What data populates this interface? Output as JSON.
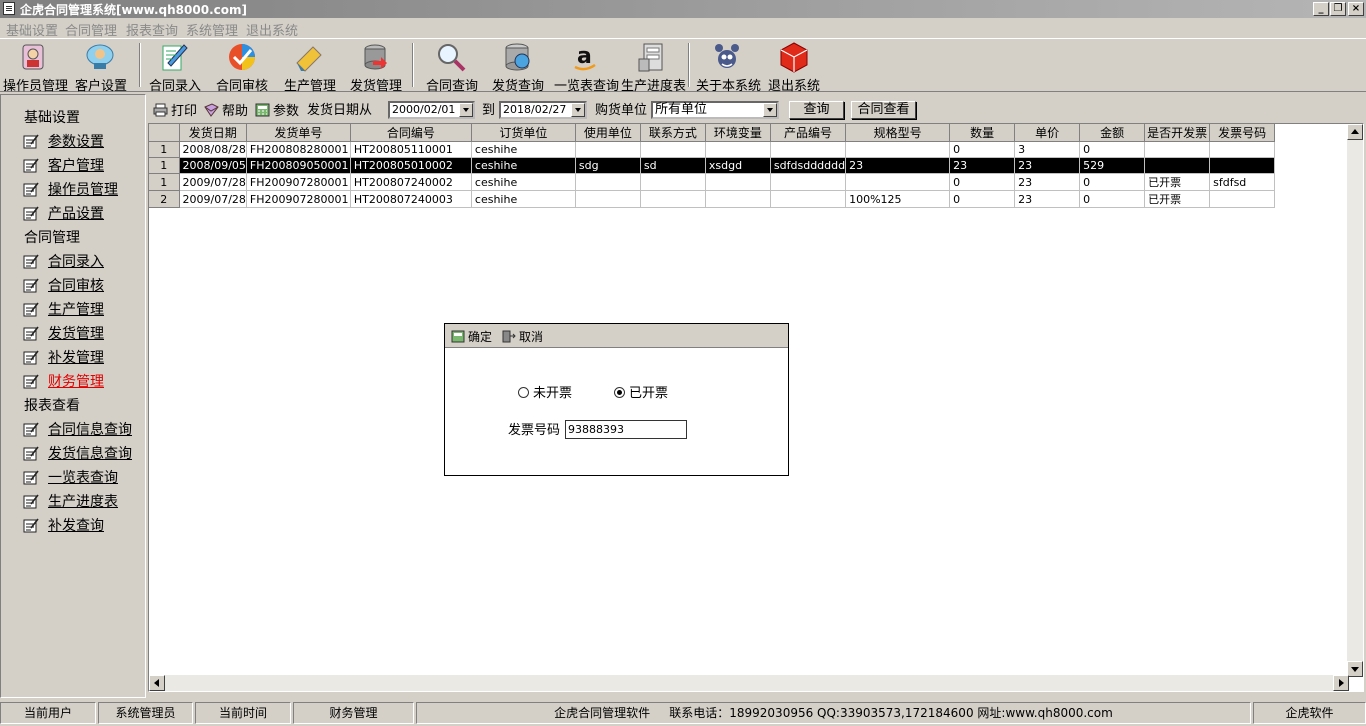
{
  "window": {
    "title": "企虎合同管理系统[www.qh8000.com]",
    "controls": [
      "_",
      "❐",
      "×"
    ]
  },
  "menu": [
    "基础设置",
    "合同管理",
    "报表查询",
    "系统管理",
    "退出系统"
  ],
  "toolbar": [
    {
      "label": "操作员管理",
      "icon": "operator-icon"
    },
    {
      "label": "客户设置",
      "icon": "customer-icon"
    },
    {
      "label": "合同录入",
      "icon": "contract-entry-icon"
    },
    {
      "label": "合同审核",
      "icon": "audit-check-icon"
    },
    {
      "label": "生产管理",
      "icon": "production-icon"
    },
    {
      "label": "发货管理",
      "icon": "shipping-icon"
    },
    {
      "label": "合同查询",
      "icon": "magnifier-icon"
    },
    {
      "label": "发货查询",
      "icon": "database-search-icon"
    },
    {
      "label": "一览表查询",
      "icon": "overview-icon"
    },
    {
      "label": "生产进度表",
      "icon": "progress-icon"
    },
    {
      "label": "关于本系统",
      "icon": "about-icon"
    },
    {
      "label": "退出系统",
      "icon": "exit-cube-icon"
    }
  ],
  "sidebar": [
    {
      "type": "group",
      "label": "基础设置"
    },
    {
      "type": "link",
      "label": "参数设置"
    },
    {
      "type": "link",
      "label": "客户管理"
    },
    {
      "type": "link",
      "label": "操作员管理"
    },
    {
      "type": "link",
      "label": "产品设置"
    },
    {
      "type": "group",
      "label": "合同管理"
    },
    {
      "type": "link",
      "label": "合同录入"
    },
    {
      "type": "link",
      "label": "合同审核"
    },
    {
      "type": "link",
      "label": "生产管理"
    },
    {
      "type": "link",
      "label": "发货管理"
    },
    {
      "type": "link",
      "label": "补发管理"
    },
    {
      "type": "link",
      "label": "财务管理",
      "active": true
    },
    {
      "type": "group",
      "label": "报表查看"
    },
    {
      "type": "link",
      "label": "合同信息查询"
    },
    {
      "type": "link",
      "label": "发货信息查询"
    },
    {
      "type": "link",
      "label": "一览表查询"
    },
    {
      "type": "link",
      "label": "生产进度表"
    },
    {
      "type": "link",
      "label": "补发查询"
    }
  ],
  "query": {
    "print": "打印",
    "help": "帮助",
    "params": "参数",
    "date_from_label": "发货日期从",
    "date_from": "2000/02/01",
    "to_label": "到",
    "date_to": "2018/02/27",
    "buyer_label": "购货单位",
    "buyer_value": "所有单位",
    "search": "查询",
    "view_contract": "合同查看"
  },
  "grid": {
    "columns": [
      "",
      "发货日期",
      "发货单号",
      "合同编号",
      "订货单位",
      "使用单位",
      "联系方式",
      "环境变量",
      "产品编号",
      "规格型号",
      "数量",
      "单价",
      "金额",
      "是否开发票",
      "发票号码"
    ],
    "rows": [
      [
        "1",
        "2008/08/28",
        "FH200808280001",
        "HT200805110001",
        "ceshihe",
        "",
        "",
        "",
        "",
        "",
        "0",
        "3",
        "0",
        "",
        ""
      ],
      [
        "1",
        "2008/09/05",
        "FH200809050001",
        "HT200805010002",
        "ceshihe",
        "sdg",
        "sd",
        "xsdgd",
        "sdfdsdddddd",
        "23",
        "23",
        "23",
        "529",
        "",
        ""
      ],
      [
        "1",
        "2009/07/28",
        "FH200907280001",
        "HT200807240002",
        "ceshihe",
        "",
        "",
        "",
        "",
        "",
        "0",
        "23",
        "0",
        "已开票",
        "sfdfsd"
      ],
      [
        "2",
        "2009/07/28",
        "FH200907280001",
        "HT200807240003",
        "ceshihe",
        "",
        "",
        "",
        "",
        "100%125",
        "0",
        "23",
        "0",
        "已开票",
        ""
      ]
    ],
    "selected_row": 1
  },
  "dialog": {
    "confirm": "确定",
    "cancel": "取消",
    "radio_no": "未开票",
    "radio_yes": "已开票",
    "selected": "radio_yes",
    "invoice_label": "发票号码",
    "invoice_value": "93888393"
  },
  "status": [
    "当前用户",
    "系统管理员",
    "当前时间",
    "财务管理",
    "企虎合同管理软件     联系电话：18992030956 QQ:33903573,172184600 网址:www.qh8000.com",
    "企虎软件"
  ]
}
